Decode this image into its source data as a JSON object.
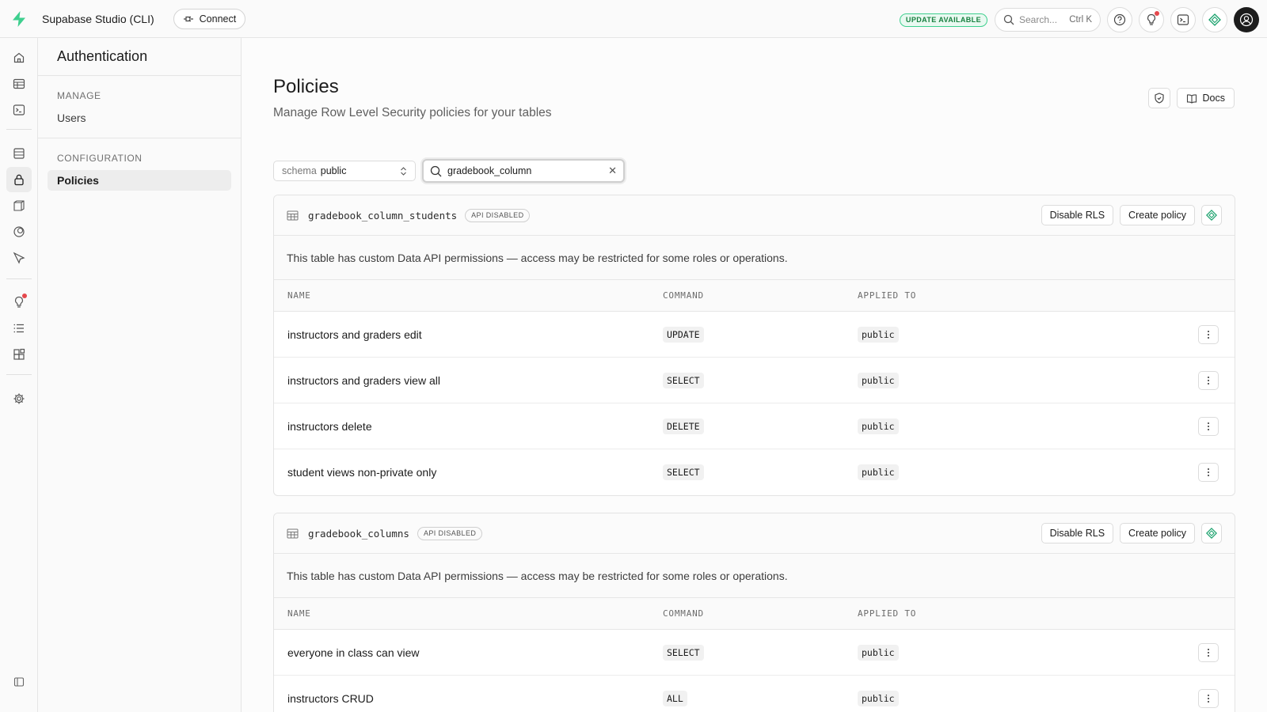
{
  "app": {
    "title": "Supabase Studio (CLI)",
    "connect_label": "Connect",
    "update_badge": "UPDATE AVAILABLE",
    "search_placeholder": "Search...",
    "search_shortcut": "Ctrl K",
    "accent_color": "#3ecf8e"
  },
  "sidepanel": {
    "title": "Authentication",
    "sections": [
      {
        "heading": "MANAGE",
        "items": [
          {
            "label": "Users",
            "active": false
          }
        ]
      },
      {
        "heading": "CONFIGURATION",
        "items": [
          {
            "label": "Policies",
            "active": true
          }
        ]
      }
    ]
  },
  "page": {
    "title": "Policies",
    "subtitle": "Manage Row Level Security policies for your tables",
    "docs_label": "Docs"
  },
  "filters": {
    "schema_label": "schema",
    "schema_value": "public",
    "search_value": "gradebook_column"
  },
  "tables": [
    {
      "name": "gradebook_column_students",
      "badge": "API DISABLED",
      "disable_label": "Disable RLS",
      "create_label": "Create policy",
      "notice": "This table has custom Data API permissions — access may be restricted for some roles or operations.",
      "columns": [
        "NAME",
        "COMMAND",
        "APPLIED TO"
      ],
      "policies": [
        {
          "name": "instructors and graders edit",
          "command": "UPDATE",
          "applied_to": "public"
        },
        {
          "name": "instructors and graders view all",
          "command": "SELECT",
          "applied_to": "public"
        },
        {
          "name": "instructors delete",
          "command": "DELETE",
          "applied_to": "public"
        },
        {
          "name": "student views non-private only",
          "command": "SELECT",
          "applied_to": "public"
        }
      ]
    },
    {
      "name": "gradebook_columns",
      "badge": "API DISABLED",
      "disable_label": "Disable RLS",
      "create_label": "Create policy",
      "notice": "This table has custom Data API permissions — access may be restricted for some roles or operations.",
      "columns": [
        "NAME",
        "COMMAND",
        "APPLIED TO"
      ],
      "policies": [
        {
          "name": "everyone in class can view",
          "command": "SELECT",
          "applied_to": "public"
        },
        {
          "name": "instructors CRUD",
          "command": "ALL",
          "applied_to": "public"
        }
      ]
    }
  ]
}
